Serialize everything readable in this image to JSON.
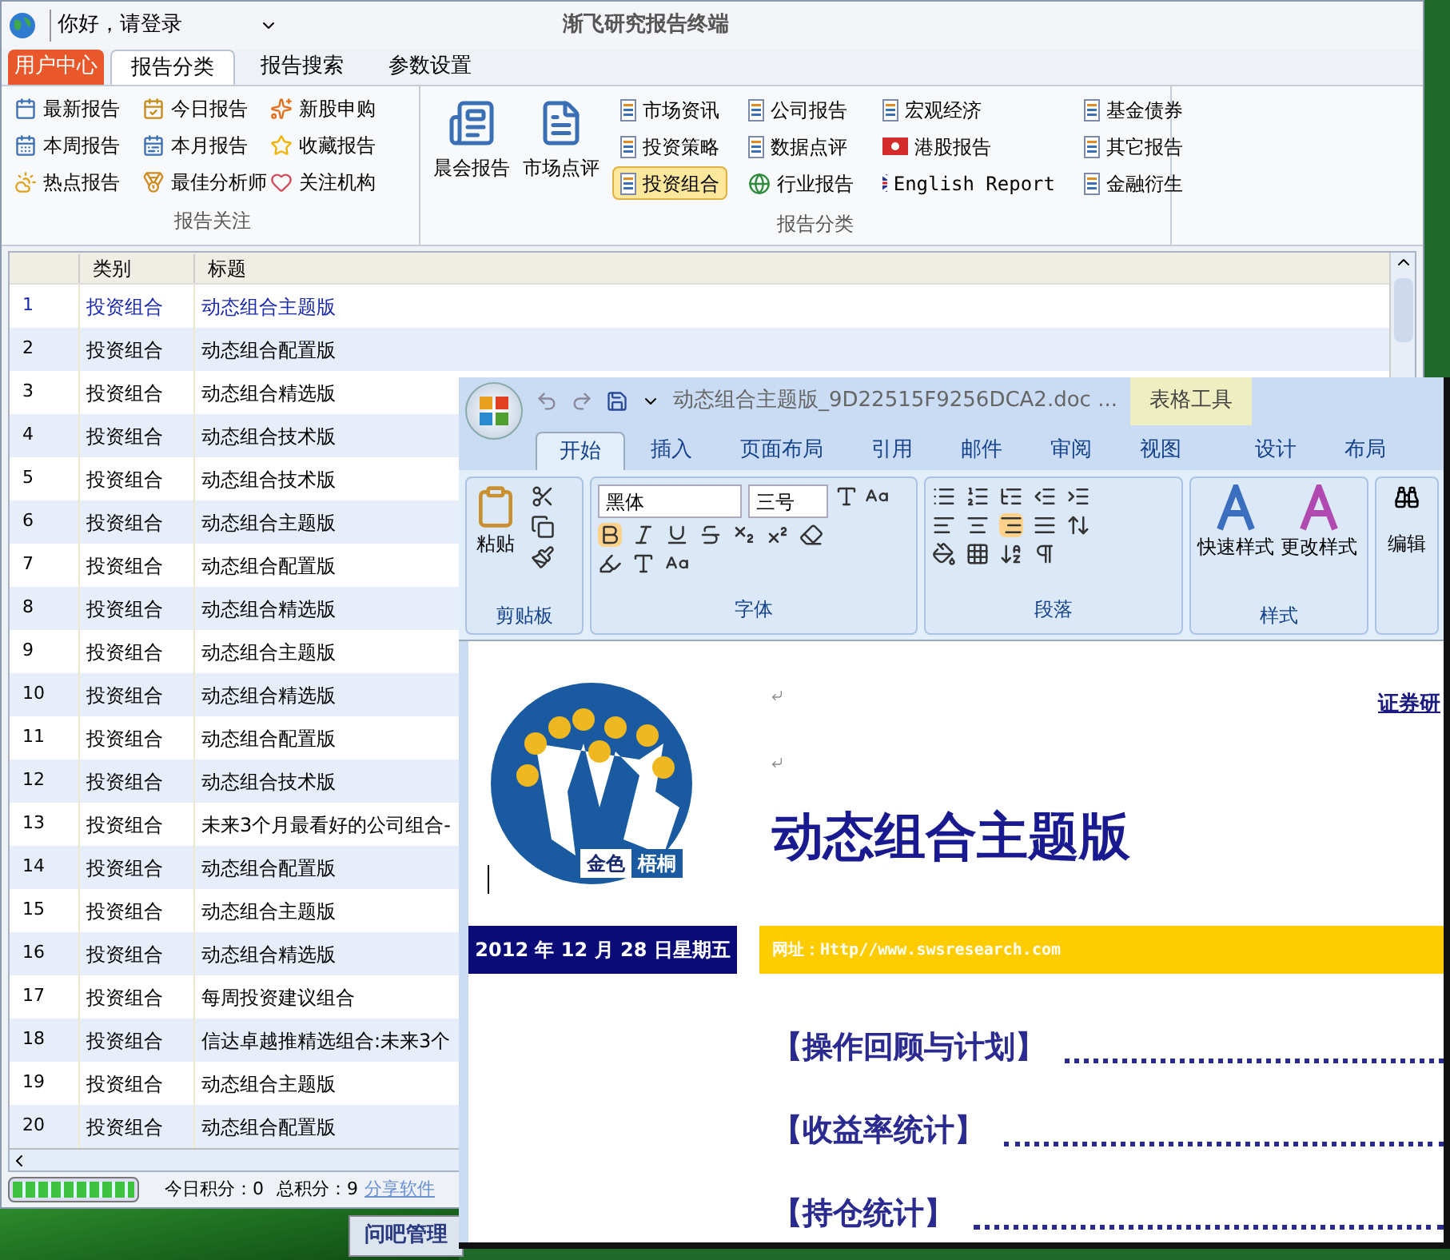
{
  "window": {
    "title": "渐飞研究报告终端",
    "greeting": "你好，请登录"
  },
  "tabs": [
    {
      "label": "用户中心",
      "kind": "accent",
      "selected": false
    },
    {
      "label": "报告分类",
      "kind": "normal",
      "selected": true
    },
    {
      "label": "报告搜索",
      "kind": "normal",
      "selected": false
    },
    {
      "label": "参数设置",
      "kind": "normal",
      "selected": false
    }
  ],
  "ribbon": {
    "focus_group": {
      "label": "报告关注",
      "items": [
        {
          "label": "最新报告"
        },
        {
          "label": "今日报告"
        },
        {
          "label": "新股申购"
        },
        {
          "label": "本周报告"
        },
        {
          "label": "本月报告"
        },
        {
          "label": "收藏报告"
        },
        {
          "label": "热点报告"
        },
        {
          "label": "最佳分析师"
        },
        {
          "label": "关注机构"
        }
      ]
    },
    "category_group": {
      "label": "报告分类",
      "large_items": [
        {
          "label": "晨会报告"
        },
        {
          "label": "市场点评"
        }
      ],
      "columns": [
        [
          {
            "label": "市场资讯",
            "selected": false
          },
          {
            "label": "投资策略",
            "selected": false
          },
          {
            "label": "投资组合",
            "selected": true
          }
        ],
        [
          {
            "label": "公司报告",
            "selected": false
          },
          {
            "label": "数据点评",
            "selected": false
          },
          {
            "label": "行业报告",
            "selected": false
          }
        ],
        [
          {
            "label": "宏观经济",
            "selected": false
          },
          {
            "label": "港股报告",
            "selected": false
          },
          {
            "label": "English Report",
            "selected": false
          }
        ],
        [
          {
            "label": "基金债券",
            "selected": false
          },
          {
            "label": "其它报告",
            "selected": false
          },
          {
            "label": "金融衍生",
            "selected": false
          }
        ]
      ]
    }
  },
  "table": {
    "columns": [
      "类别",
      "标题"
    ],
    "rows": [
      {
        "no": "1",
        "category": "投资组合",
        "title": "动态组合主题版",
        "selected": true
      },
      {
        "no": "2",
        "category": "投资组合",
        "title": "动态组合配置版",
        "selected": false
      },
      {
        "no": "3",
        "category": "投资组合",
        "title": "动态组合精选版",
        "selected": false
      },
      {
        "no": "4",
        "category": "投资组合",
        "title": "动态组合技术版",
        "selected": false
      },
      {
        "no": "5",
        "category": "投资组合",
        "title": "动态组合技术版",
        "selected": false
      },
      {
        "no": "6",
        "category": "投资组合",
        "title": "动态组合主题版",
        "selected": false
      },
      {
        "no": "7",
        "category": "投资组合",
        "title": "动态组合配置版",
        "selected": false
      },
      {
        "no": "8",
        "category": "投资组合",
        "title": "动态组合精选版",
        "selected": false
      },
      {
        "no": "9",
        "category": "投资组合",
        "title": "动态组合主题版",
        "selected": false
      },
      {
        "no": "10",
        "category": "投资组合",
        "title": "动态组合精选版",
        "selected": false
      },
      {
        "no": "11",
        "category": "投资组合",
        "title": "动态组合配置版",
        "selected": false
      },
      {
        "no": "12",
        "category": "投资组合",
        "title": "动态组合技术版",
        "selected": false
      },
      {
        "no": "13",
        "category": "投资组合",
        "title": "未来3个月最看好的公司组合-",
        "selected": false
      },
      {
        "no": "14",
        "category": "投资组合",
        "title": "动态组合配置版",
        "selected": false
      },
      {
        "no": "15",
        "category": "投资组合",
        "title": "动态组合主题版",
        "selected": false
      },
      {
        "no": "16",
        "category": "投资组合",
        "title": "动态组合精选版",
        "selected": false
      },
      {
        "no": "17",
        "category": "投资组合",
        "title": "每周投资建议组合",
        "selected": false
      },
      {
        "no": "18",
        "category": "投资组合",
        "title": "信达卓越推精选组合:未来3个",
        "selected": false
      },
      {
        "no": "19",
        "category": "投资组合",
        "title": "动态组合主题版",
        "selected": false
      },
      {
        "no": "20",
        "category": "投资组合",
        "title": "动态组合配置版",
        "selected": false
      }
    ]
  },
  "status_bar": {
    "progress": {
      "level": 1
    },
    "today_points": "今日积分：0",
    "total_points": "总积分：9",
    "share_link": "分享软件"
  },
  "taskbar": {
    "button": "问吧管理"
  },
  "word": {
    "title": "动态组合主题版_9D22515F9256DCA2.doc ...",
    "context_label": "表格工具",
    "tabs": [
      {
        "label": "开始",
        "kind": "normal",
        "selected": true
      },
      {
        "label": "插入",
        "kind": "normal",
        "selected": false
      },
      {
        "label": "页面布局",
        "kind": "normal",
        "selected": false
      },
      {
        "label": "引用",
        "kind": "normal",
        "selected": false
      },
      {
        "label": "邮件",
        "kind": "normal",
        "selected": false
      },
      {
        "label": "审阅",
        "kind": "normal",
        "selected": false
      },
      {
        "label": "视图",
        "kind": "normal",
        "selected": false
      },
      {
        "label": "设计",
        "kind": "context",
        "selected": false
      },
      {
        "label": "布局",
        "kind": "context",
        "selected": false
      }
    ],
    "clipboard": {
      "label": "剪贴板",
      "paste": "粘贴"
    },
    "font": {
      "label": "字体",
      "name": "黑体",
      "size": "三号"
    },
    "paragraph": {
      "label": "段落"
    },
    "styles": {
      "label": "样式",
      "quick": "快速样式",
      "change": "更改样式"
    },
    "editing": {
      "label": "编辑"
    },
    "document": {
      "header_link": "证券研",
      "logo_text": [
        "金色",
        "梧桐"
      ],
      "title": "动态组合主题版",
      "date": "2012 年 12 月 28 日星期五",
      "url": "网址：Http//www.swsresearch.com",
      "sections": [
        "【操作回顾与计划】",
        "【收益率统计】",
        "【持仓统计】"
      ]
    }
  }
}
